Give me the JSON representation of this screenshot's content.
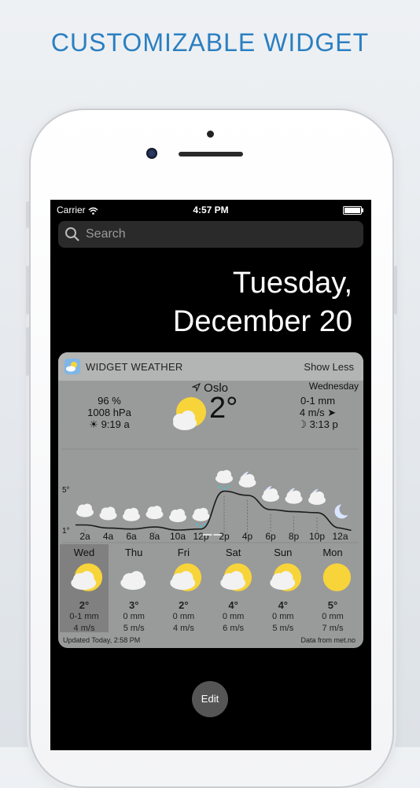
{
  "headline": "CUSTOMIZABLE WIDGET",
  "status_bar": {
    "carrier": "Carrier",
    "time": "4:57 PM"
  },
  "search": {
    "placeholder": "Search"
  },
  "date": {
    "line1": "Tuesday,",
    "line2": "December 20"
  },
  "widget": {
    "title": "WIDGET WEATHER",
    "show_less": "Show Less",
    "current": {
      "city": "Oslo",
      "temperature": "2°",
      "weekday": "Wednesday",
      "humidity": "96 %",
      "pressure": "1008 hPa",
      "sunrise": "9:19 a",
      "precipitation": "0-1 mm",
      "wind": "4 m/s",
      "moonrise": "3:13 p"
    },
    "chart_data": {
      "type": "line",
      "x": [
        "2a",
        "4a",
        "6a",
        "8a",
        "10a",
        "12p",
        "2p",
        "4p",
        "6p",
        "8p",
        "10p",
        "12a"
      ],
      "y_ticks": [
        "5°",
        "1°"
      ],
      "series": [
        {
          "values": [
            1.5,
            1.2,
            1.1,
            1.3,
            1.0,
            1.1,
            4.8,
            4.4,
            3.0,
            2.8,
            2.7,
            1.2
          ]
        }
      ],
      "icons": [
        "cloud",
        "cloud",
        "cloud",
        "cloud",
        "cloud",
        "cloud-rain",
        "cloud-snow",
        "moon-cloud",
        "moon-cloud",
        "moon-cloud",
        "moon-cloud",
        "moon"
      ]
    },
    "days": [
      {
        "name": "Wed",
        "temp": "2°",
        "precip": "0-1 mm",
        "wind": "4 m/s",
        "icon": "sun-cloud"
      },
      {
        "name": "Thu",
        "temp": "3°",
        "precip": "0 mm",
        "wind": "5 m/s",
        "icon": "cloud"
      },
      {
        "name": "Fri",
        "temp": "2°",
        "precip": "0 mm",
        "wind": "4 m/s",
        "icon": "sun-cloud"
      },
      {
        "name": "Sat",
        "temp": "4°",
        "precip": "0 mm",
        "wind": "6 m/s",
        "icon": "sun-cloud"
      },
      {
        "name": "Sun",
        "temp": "4°",
        "precip": "0 mm",
        "wind": "5 m/s",
        "icon": "sun-cloud"
      },
      {
        "name": "Mon",
        "temp": "5°",
        "precip": "0 mm",
        "wind": "7 m/s",
        "icon": "sun"
      }
    ],
    "updated": "Updated Today, 2:58 PM",
    "source": "Data from met.no"
  },
  "edit_button": "Edit",
  "colors": {
    "headline": "#2b7fc1",
    "sun": "#f7d43a",
    "widget_bg": "#999a9a"
  }
}
